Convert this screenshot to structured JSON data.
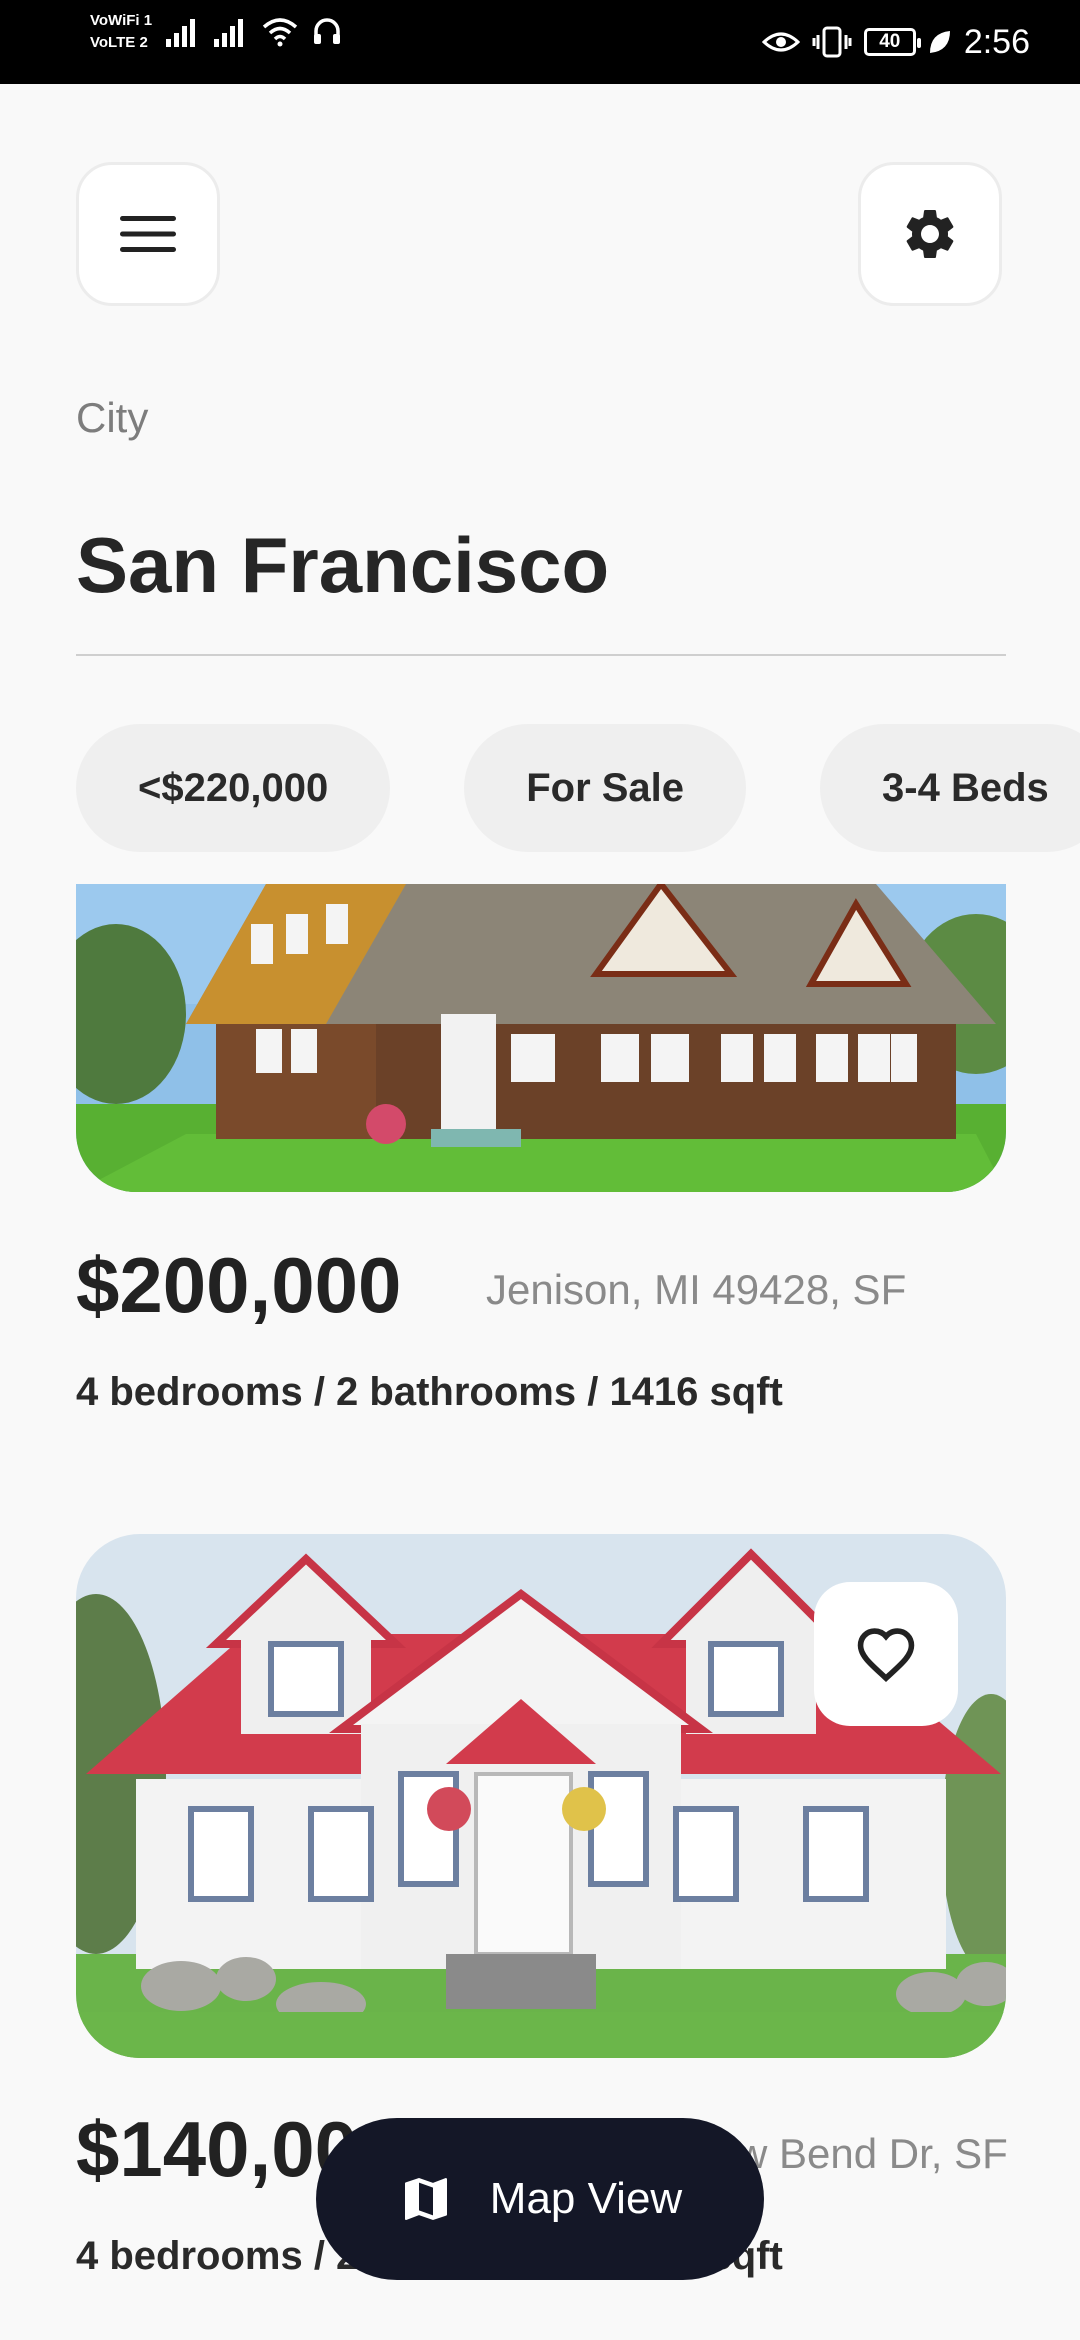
{
  "status_bar": {
    "left_badges": [
      "VoWiFi 1",
      "VoLTE 2"
    ],
    "battery": "40",
    "time": "2:56"
  },
  "header": {
    "menu_icon": "hamburger-menu-icon",
    "settings_icon": "gear-icon"
  },
  "location": {
    "label": "City",
    "value": "San Francisco"
  },
  "filters": [
    "<$220,000",
    "For Sale",
    "3-4 Beds"
  ],
  "listings": [
    {
      "price": "$200,000",
      "address": "Jenison, MI 49428, SF",
      "details": "4 bedrooms / 2 bathrooms / 1416 sqft"
    },
    {
      "price": "$140,000",
      "address": "Willow Bend Dr, SF",
      "details": "4 bedrooms / 2 bathrooms / 1416 sqft",
      "favorite_icon": "heart-icon"
    }
  ],
  "map_button": {
    "label": "Map View",
    "icon": "map-icon"
  },
  "colors": {
    "background": "#f9f9f9",
    "chip": "#efefef",
    "map_button": "#141727",
    "text_primary": "#242424",
    "text_secondary": "#8a8a8a"
  }
}
